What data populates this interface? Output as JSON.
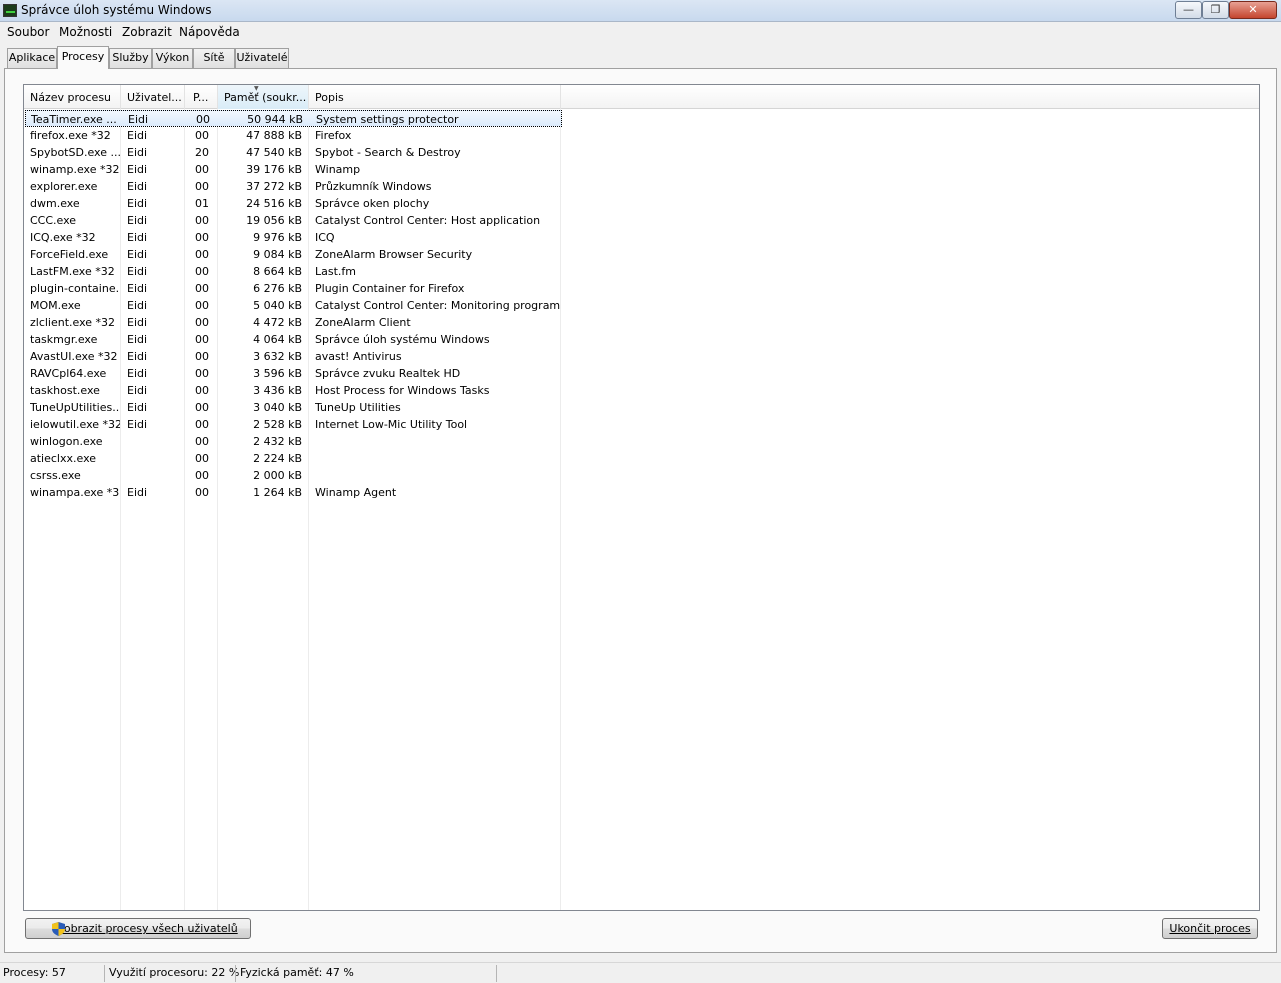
{
  "window": {
    "title": "Správce úloh systému Windows",
    "min_glyph": "—",
    "max_glyph": "❐",
    "close_glyph": "✕"
  },
  "menu": [
    "Soubor",
    "Možnosti",
    "Zobrazit",
    "Nápověda"
  ],
  "tabs": [
    "Aplikace",
    "Procesy",
    "Služby",
    "Výkon",
    "Sítě",
    "Uživatelé"
  ],
  "active_tab": "Procesy",
  "columns": [
    "Název procesu",
    "Uživatel...",
    "P...",
    "Paměť (soukr...",
    "Popis"
  ],
  "sorted_column": "Paměť (soukr...",
  "processes": [
    {
      "name": "TeaTimer.exe ...",
      "user": "Eidi",
      "cpu": "00",
      "mem": "50 944 kB",
      "desc": "System settings protector"
    },
    {
      "name": "firefox.exe *32",
      "user": "Eidi",
      "cpu": "00",
      "mem": "47 888 kB",
      "desc": "Firefox"
    },
    {
      "name": "SpybotSD.exe ...",
      "user": "Eidi",
      "cpu": "20",
      "mem": "47 540 kB",
      "desc": "Spybot - Search & Destroy"
    },
    {
      "name": "winamp.exe *32",
      "user": "Eidi",
      "cpu": "00",
      "mem": "39 176 kB",
      "desc": "Winamp"
    },
    {
      "name": "explorer.exe",
      "user": "Eidi",
      "cpu": "00",
      "mem": "37 272 kB",
      "desc": "Průzkumník Windows"
    },
    {
      "name": "dwm.exe",
      "user": "Eidi",
      "cpu": "01",
      "mem": "24 516 kB",
      "desc": "Správce oken plochy"
    },
    {
      "name": "CCC.exe",
      "user": "Eidi",
      "cpu": "00",
      "mem": "19 056 kB",
      "desc": "Catalyst Control Center: Host application"
    },
    {
      "name": "ICQ.exe *32",
      "user": "Eidi",
      "cpu": "00",
      "mem": "9 976 kB",
      "desc": "ICQ"
    },
    {
      "name": "ForceField.exe",
      "user": "Eidi",
      "cpu": "00",
      "mem": "9 084 kB",
      "desc": "ZoneAlarm Browser Security"
    },
    {
      "name": "LastFM.exe *32",
      "user": "Eidi",
      "cpu": "00",
      "mem": "8 664 kB",
      "desc": "Last.fm"
    },
    {
      "name": "plugin-containe...",
      "user": "Eidi",
      "cpu": "00",
      "mem": "6 276 kB",
      "desc": "Plugin Container for Firefox"
    },
    {
      "name": "MOM.exe",
      "user": "Eidi",
      "cpu": "00",
      "mem": "5 040 kB",
      "desc": "Catalyst Control Center: Monitoring program"
    },
    {
      "name": "zlclient.exe *32",
      "user": "Eidi",
      "cpu": "00",
      "mem": "4 472 kB",
      "desc": "ZoneAlarm Client"
    },
    {
      "name": "taskmgr.exe",
      "user": "Eidi",
      "cpu": "00",
      "mem": "4 064 kB",
      "desc": "Správce úloh systému Windows"
    },
    {
      "name": "AvastUI.exe *32",
      "user": "Eidi",
      "cpu": "00",
      "mem": "3 632 kB",
      "desc": "avast! Antivirus"
    },
    {
      "name": "RAVCpl64.exe",
      "user": "Eidi",
      "cpu": "00",
      "mem": "3 596 kB",
      "desc": "Správce zvuku Realtek HD"
    },
    {
      "name": "taskhost.exe",
      "user": "Eidi",
      "cpu": "00",
      "mem": "3 436 kB",
      "desc": "Host Process for Windows Tasks"
    },
    {
      "name": "TuneUpUtilities...",
      "user": "Eidi",
      "cpu": "00",
      "mem": "3 040 kB",
      "desc": "TuneUp Utilities"
    },
    {
      "name": "ielowutil.exe *32",
      "user": "Eidi",
      "cpu": "00",
      "mem": "2 528 kB",
      "desc": "Internet Low-Mic Utility Tool"
    },
    {
      "name": "winlogon.exe",
      "user": "",
      "cpu": "00",
      "mem": "2 432 kB",
      "desc": ""
    },
    {
      "name": "atieclxx.exe",
      "user": "",
      "cpu": "00",
      "mem": "2 224 kB",
      "desc": ""
    },
    {
      "name": "csrss.exe",
      "user": "",
      "cpu": "00",
      "mem": "2 000 kB",
      "desc": ""
    },
    {
      "name": "winampa.exe *32",
      "user": "Eidi",
      "cpu": "00",
      "mem": "1 264 kB",
      "desc": "Winamp Agent"
    }
  ],
  "selected_row": "TeaTimer.exe ...",
  "buttons": {
    "show_all": "Zobrazit procesy všech uživatelů",
    "end_process": "Ukončit proces"
  },
  "status": {
    "processes": "Procesy: 57",
    "cpu": "Využití procesoru: 22 %",
    "memory": "Fyzická paměť: 47 %"
  },
  "colors": {
    "selection": "#dcebfc",
    "sorted_header": "#d9ecf7",
    "window_bg": "#f0f0f0"
  }
}
